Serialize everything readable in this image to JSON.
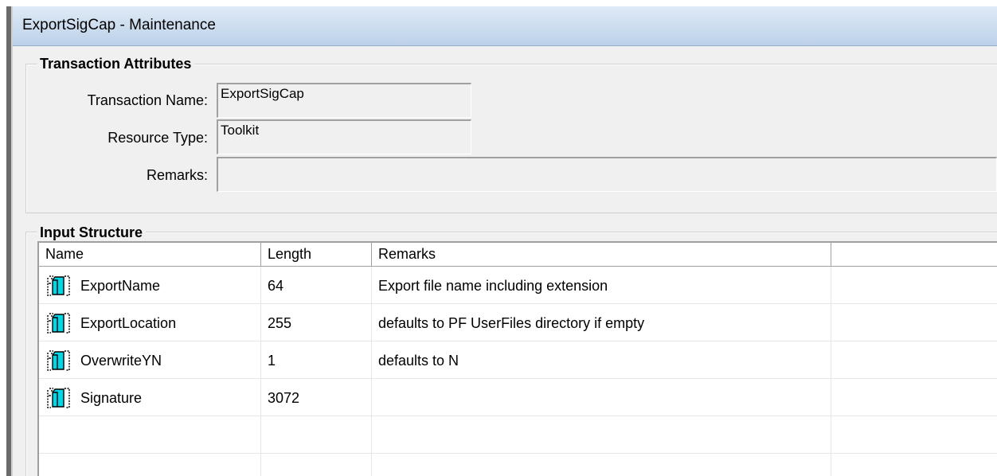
{
  "window": {
    "title": "ExportSigCap - Maintenance"
  },
  "attributes": {
    "group_label": "Transaction Attributes",
    "transaction_name_label": "Transaction Name:",
    "transaction_name_value": "ExportSigCap",
    "resource_type_label": "Resource Type:",
    "resource_type_value": "Toolkit",
    "remarks_label": "Remarks:",
    "remarks_value": ""
  },
  "input_structure": {
    "group_label": "Input Structure",
    "columns": [
      "Name",
      "Length",
      "Remarks",
      ""
    ],
    "rows": [
      {
        "name": "ExportName",
        "length": "64",
        "remarks": "Export file name including extension",
        "icon": "field-icon"
      },
      {
        "name": "ExportLocation",
        "length": "255",
        "remarks": "defaults to PF UserFiles directory if empty",
        "icon": "field-icon"
      },
      {
        "name": "OverwriteYN",
        "length": "1",
        "remarks": "defaults to N",
        "icon": "field-icon"
      },
      {
        "name": "Signature",
        "length": "3072",
        "remarks": "",
        "icon": "field-icon"
      }
    ]
  },
  "colors": {
    "titlebar_top": "#dfeaf6",
    "titlebar_bottom": "#bcd1e8",
    "icon_accent": "#00d8e8",
    "window_bg": "#f0f0f0"
  }
}
